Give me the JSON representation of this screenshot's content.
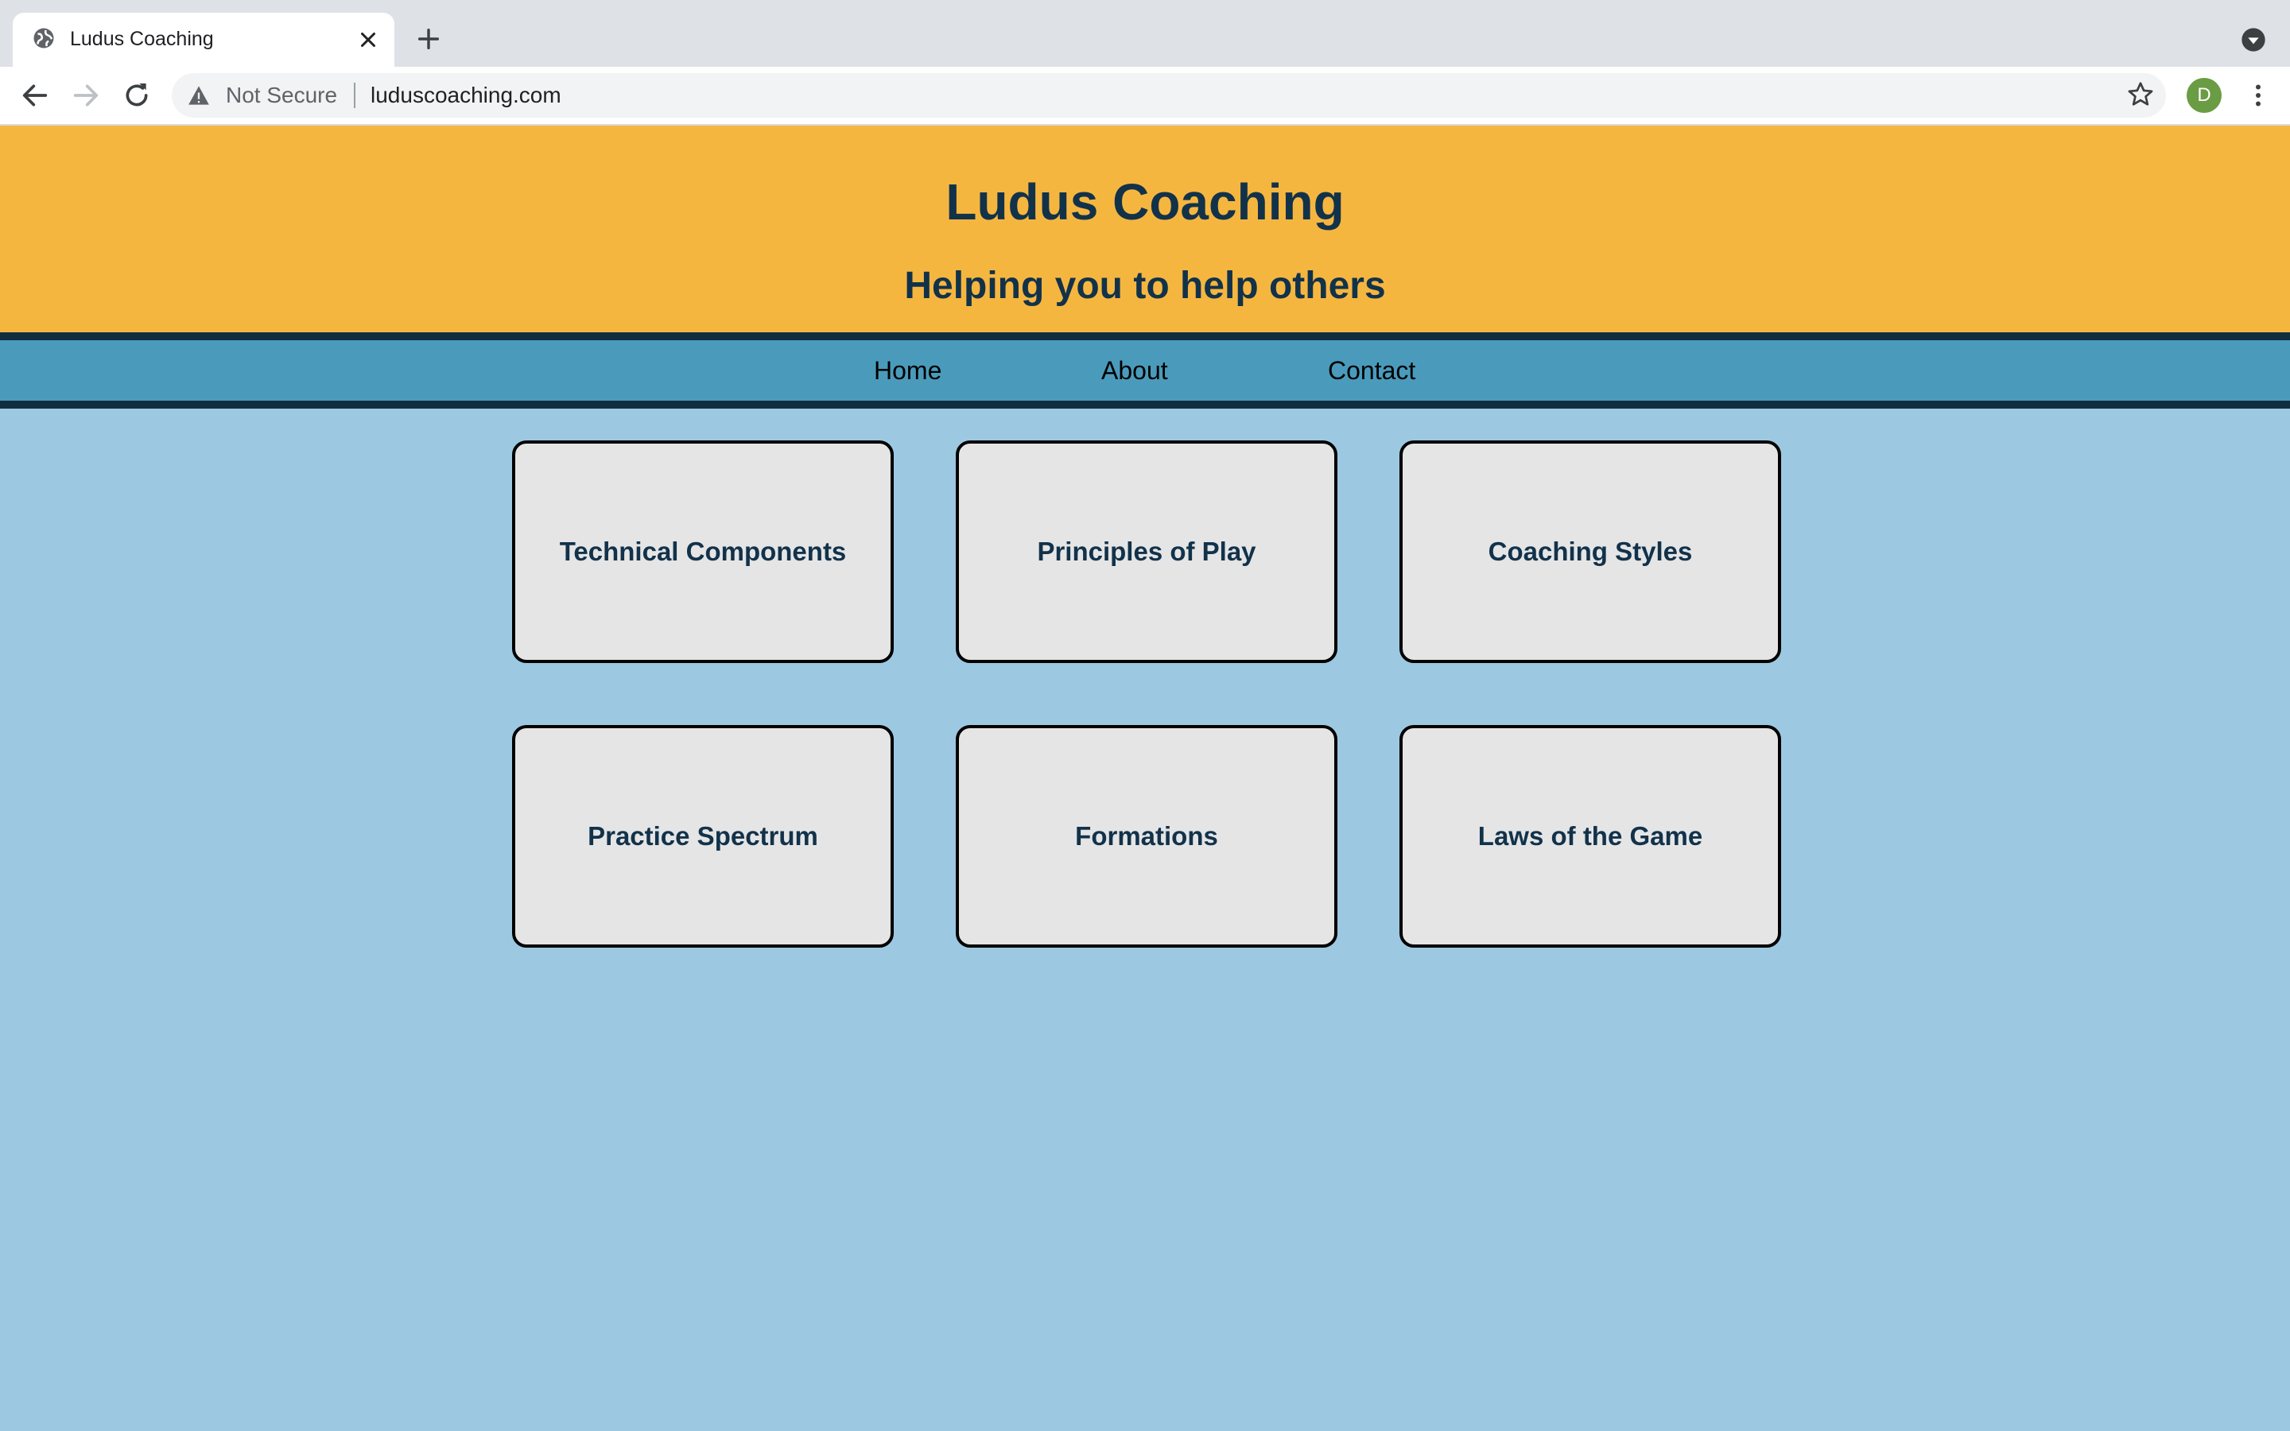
{
  "browser": {
    "tab_title": "Ludus Coaching",
    "security_label": "Not Secure",
    "url": "luduscoaching.com",
    "profile_initial": "D"
  },
  "header": {
    "title": "Ludus Coaching",
    "tagline": "Helping you to help others"
  },
  "nav": {
    "items": [
      {
        "label": "Home"
      },
      {
        "label": "About"
      },
      {
        "label": "Contact"
      }
    ]
  },
  "cards": [
    {
      "label": "Technical Components"
    },
    {
      "label": "Principles of Play"
    },
    {
      "label": "Coaching Styles"
    },
    {
      "label": "Practice Spectrum"
    },
    {
      "label": "Formations"
    },
    {
      "label": "Laws of the Game"
    }
  ],
  "colors": {
    "header_bg": "#f5b640",
    "nav_bg": "#4a9bbb",
    "nav_border": "#102e40",
    "page_bg": "#9cc8e2",
    "card_bg": "#e5e5e6",
    "heading_text": "#12324a"
  }
}
